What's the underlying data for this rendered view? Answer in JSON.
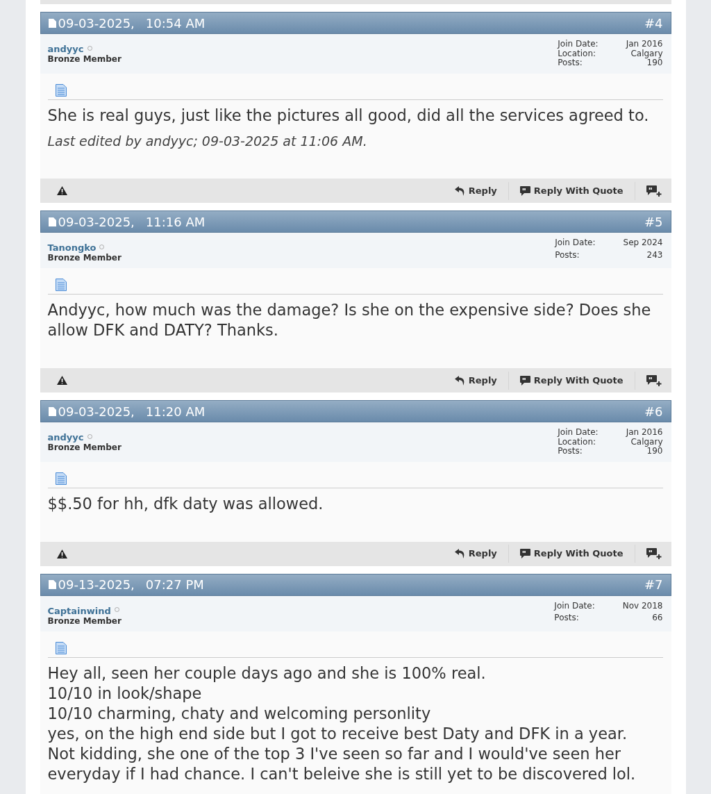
{
  "posts": [
    {
      "date": "09-03-2025,",
      "time": "10:54 AM",
      "number": "#4",
      "user": {
        "name": "andyyc",
        "rank": "Bronze Member",
        "online": false
      },
      "stats": [
        {
          "label": "Join Date:",
          "value": "Jan 2016"
        },
        {
          "label": "Location:",
          "value": "Calgary"
        },
        {
          "label": "Posts:",
          "value": "190"
        }
      ],
      "message": [
        "She is real guys, just like the pictures all good, did all the services agreed to."
      ],
      "edit_note": "Last edited by andyyc; 09-03-2025 at 11:06 AM.",
      "actions": [
        {
          "kind": "reply",
          "label": "Reply"
        },
        {
          "kind": "quote",
          "label": "Reply With Quote"
        },
        {
          "kind": "multiquote"
        }
      ]
    },
    {
      "date": "09-03-2025,",
      "time": "11:16 AM",
      "number": "#5",
      "user": {
        "name": "Tanongko",
        "rank": "Bronze Member",
        "online": false
      },
      "stats": [
        {
          "label": "Join Date:",
          "value": "Sep 2024"
        },
        {
          "label": "Posts:",
          "value": "243"
        }
      ],
      "message": [
        "Andyyc, how much was the damage? Is she on the expensive side? Does she allow DFK and DATY? Thanks."
      ],
      "actions": [
        {
          "kind": "reply",
          "label": "Reply"
        },
        {
          "kind": "quote",
          "label": "Reply With Quote"
        },
        {
          "kind": "multiquote"
        }
      ]
    },
    {
      "date": "09-03-2025,",
      "time": "11:20 AM",
      "number": "#6",
      "user": {
        "name": "andyyc",
        "rank": "Bronze Member",
        "online": false
      },
      "stats": [
        {
          "label": "Join Date:",
          "value": "Jan 2016"
        },
        {
          "label": "Location:",
          "value": "Calgary"
        },
        {
          "label": "Posts:",
          "value": "190"
        }
      ],
      "message": [
        "$$.50 for hh, dfk daty was allowed."
      ],
      "actions": [
        {
          "kind": "reply",
          "label": "Reply"
        },
        {
          "kind": "quote",
          "label": "Reply With Quote"
        },
        {
          "kind": "multiquote"
        }
      ]
    },
    {
      "date": "09-13-2025,",
      "time": "07:27 PM",
      "number": "#7",
      "user": {
        "name": "Captainwind",
        "rank": "Bronze Member",
        "online": false
      },
      "stats": [
        {
          "label": "Join Date:",
          "value": "Nov 2018"
        },
        {
          "label": "Posts:",
          "value": "66"
        }
      ],
      "message": [
        "Hey all, seen her couple days ago and she is 100% real.",
        "10/10 in look/shape",
        "10/10 charming, chaty and welcoming personlity",
        "yes, on the high end side but I got to receive best Daty and DFK in a year.",
        "Not kidding, she one of the top 3 I've seen so far and I would've seen her everyday if I had chance. I can't beleive she is still yet to be discovered lol."
      ]
    }
  ]
}
